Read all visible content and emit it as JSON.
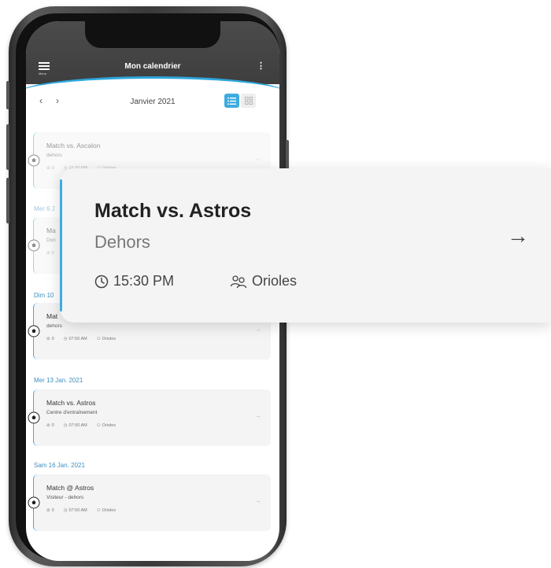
{
  "header": {
    "menu_label": "Menu",
    "title": "Mon calendrier"
  },
  "month_bar": {
    "month": "Janvier 2021",
    "prev_icon": "chevron-left-icon",
    "next_icon": "chevron-right-icon",
    "active_view": "list"
  },
  "date_headings": {
    "d1": "Mer 6 J",
    "d2": "Dim 10",
    "d3": "Mer 13 Jan. 2021",
    "d4": "Sam 16 Jan. 2021"
  },
  "events": [
    {
      "title": "Match vs. Ascalon",
      "location": "dehors",
      "count": "0",
      "time": "15:30 PM",
      "team": "Orioles"
    },
    {
      "title": "Ma",
      "location": "Don",
      "count": "0",
      "time": "",
      "team": ""
    },
    {
      "title": "Mat",
      "location": "dehors",
      "count": "0",
      "time": "07:50 AM",
      "team": "Orioles"
    },
    {
      "title": "Match vs. Astros",
      "location": "Centre d'entraînement",
      "count": "0",
      "time": "07:50 AM",
      "team": "Orioles"
    },
    {
      "title": "Match @ Astros",
      "location": "Visiteur - dehors",
      "count": "0",
      "time": "07:50 AM",
      "team": "Orioles"
    }
  ],
  "detail": {
    "title": "Match vs. Astros",
    "location": "Dehors",
    "time": "15:30 PM",
    "team": "Orioles"
  },
  "colors": {
    "accent": "#3eacde",
    "header_bg": "#424242",
    "card_bg": "#f4f4f4"
  }
}
